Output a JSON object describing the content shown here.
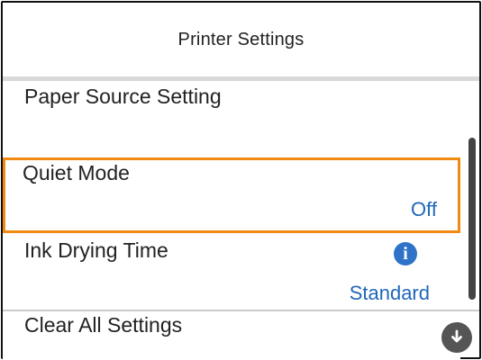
{
  "header": {
    "title": "Printer Settings"
  },
  "settings": {
    "items": [
      {
        "label": "Paper Source Setting",
        "value": ""
      },
      {
        "label": "Quiet Mode",
        "value": "Off",
        "selected": true
      },
      {
        "label": "Ink Drying Time",
        "value": "Standard",
        "icon": "info-icon"
      },
      {
        "label": "Clear All Settings",
        "value": ""
      }
    ]
  },
  "controls": {
    "scroll_down_icon": "arrow-down-icon"
  },
  "colors": {
    "accent_value": "#1f67b9",
    "selection_outline": "#f08a13",
    "info_icon": "#2e73c7"
  }
}
